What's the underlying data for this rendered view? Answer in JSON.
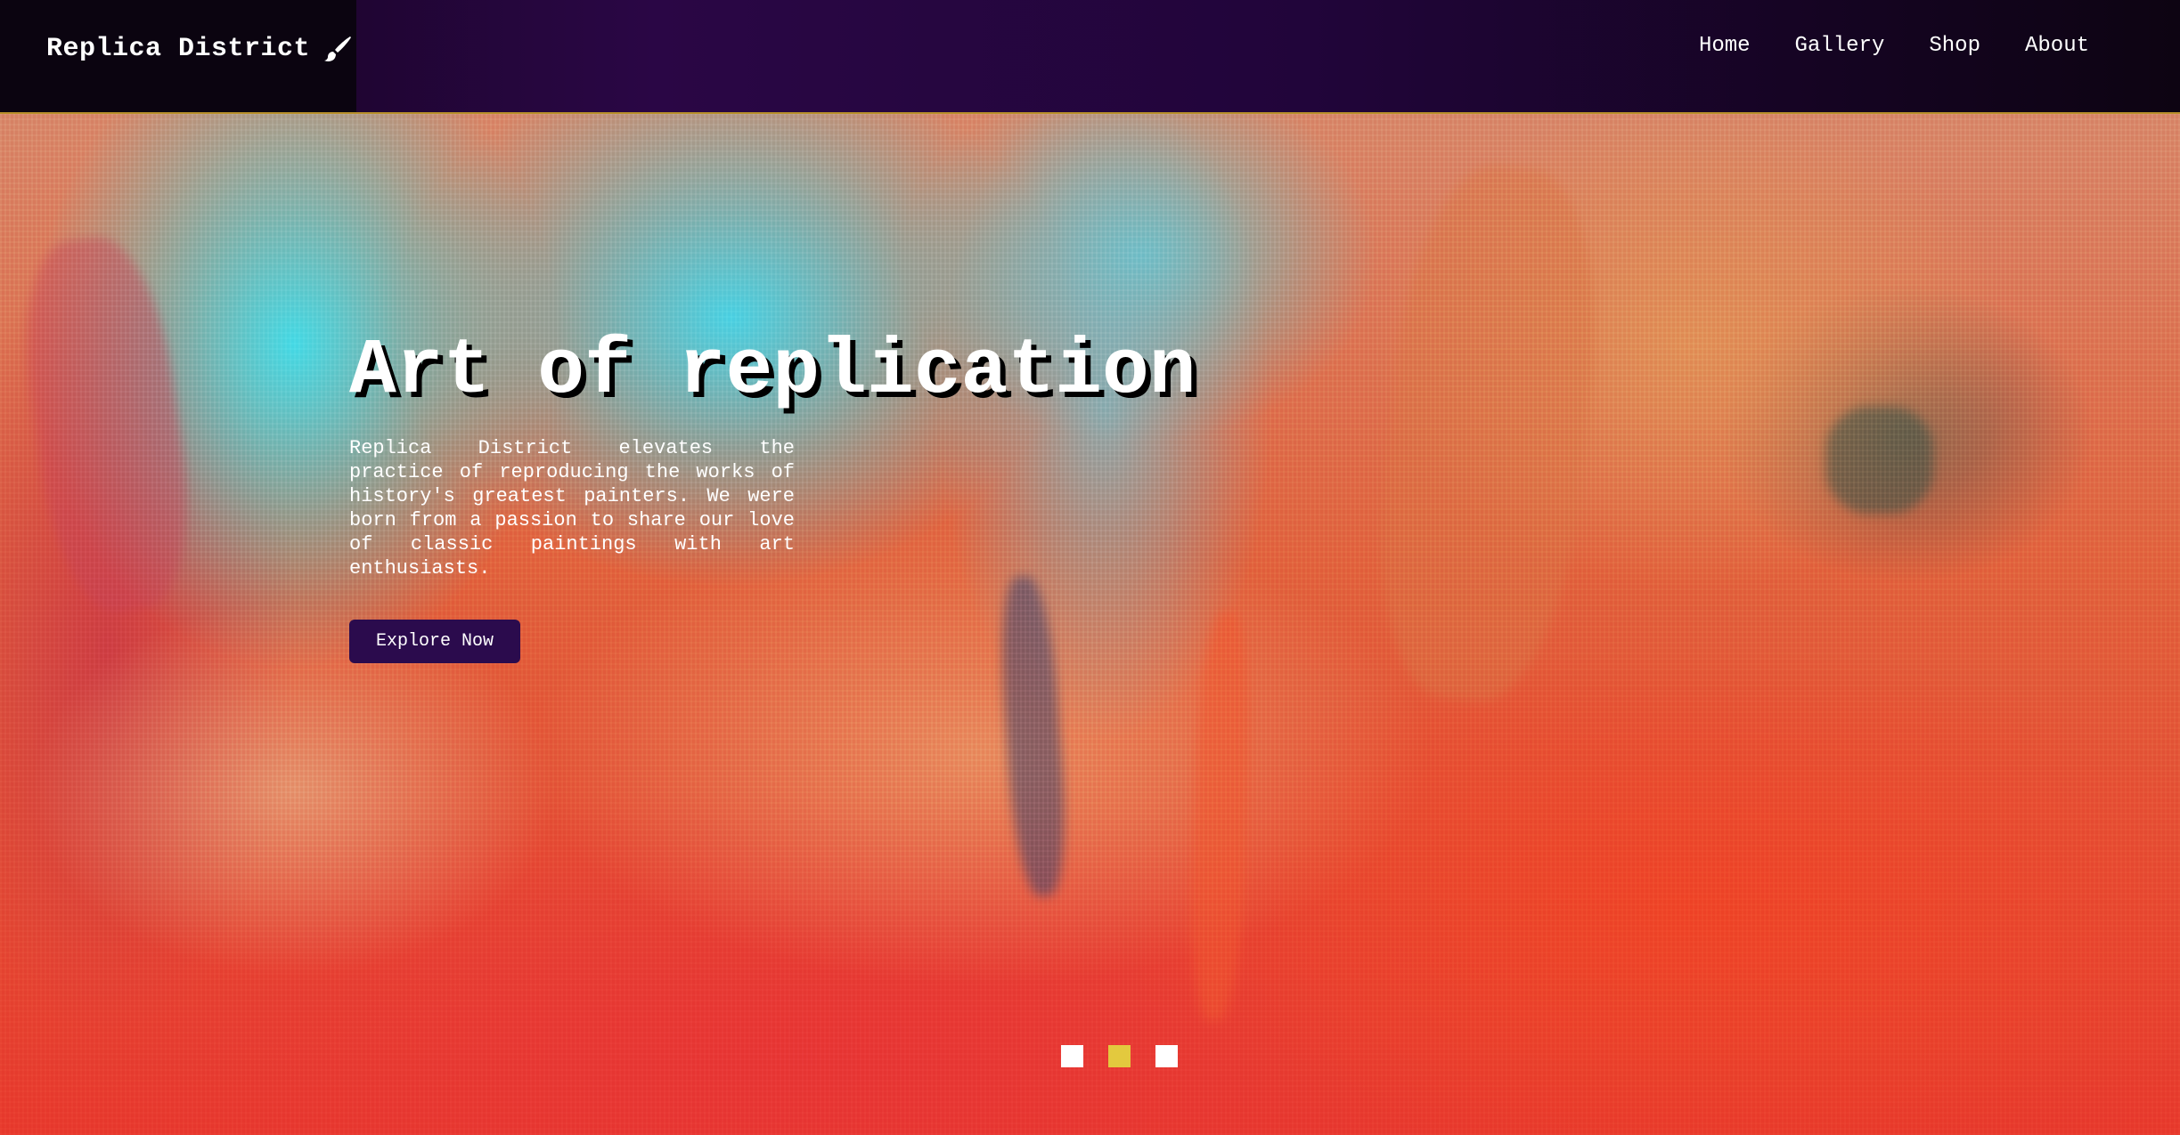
{
  "brand": {
    "name": "Replica District",
    "icon": "paintbrush-icon"
  },
  "nav": {
    "items": [
      {
        "label": "Home"
      },
      {
        "label": "Gallery"
      },
      {
        "label": "Shop"
      },
      {
        "label": "About"
      }
    ]
  },
  "hero": {
    "title": "Art of replication",
    "description": "Replica District elevates the practice of reproducing the works of history's greatest painters. We were born from a passion to share our love of classic paintings with art enthusiasts.",
    "cta_label": "Explore Now"
  },
  "carousel": {
    "slide_count": 3,
    "active_index": 1
  },
  "colors": {
    "navbar_bg": "#21053a",
    "navbar_border": "#b8902a",
    "button_bg": "#2b0b4d",
    "active_dot": "#e3c93e",
    "inactive_dot": "#ffffff"
  }
}
